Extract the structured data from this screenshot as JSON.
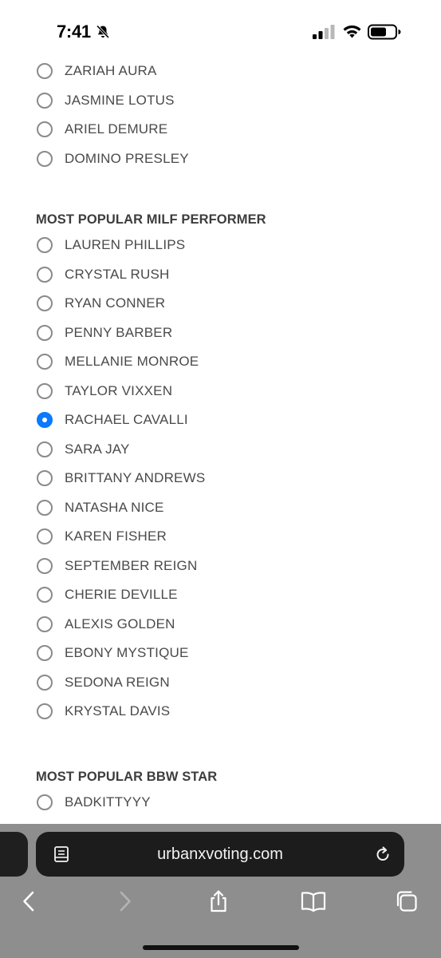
{
  "status_bar": {
    "time": "7:41"
  },
  "sections": [
    {
      "title": "",
      "options": [
        {
          "label": "ZARIAH AURA",
          "selected": false
        },
        {
          "label": "JASMINE LOTUS",
          "selected": false
        },
        {
          "label": "ARIEL DEMURE",
          "selected": false
        },
        {
          "label": "DOMINO PRESLEY",
          "selected": false
        }
      ]
    },
    {
      "title": "MOST POPULAR MILF PERFORMER",
      "options": [
        {
          "label": "LAUREN PHILLIPS",
          "selected": false
        },
        {
          "label": "CRYSTAL RUSH",
          "selected": false
        },
        {
          "label": "RYAN CONNER",
          "selected": false
        },
        {
          "label": "PENNY BARBER",
          "selected": false
        },
        {
          "label": "MELLANIE MONROE",
          "selected": false
        },
        {
          "label": "TAYLOR VIXXEN",
          "selected": false
        },
        {
          "label": "RACHAEL CAVALLI",
          "selected": true
        },
        {
          "label": "SARA JAY",
          "selected": false
        },
        {
          "label": "BRITTANY ANDREWS",
          "selected": false
        },
        {
          "label": "NATASHA NICE",
          "selected": false
        },
        {
          "label": "KAREN FISHER",
          "selected": false
        },
        {
          "label": "SEPTEMBER REIGN",
          "selected": false
        },
        {
          "label": "CHERIE DEVILLE",
          "selected": false
        },
        {
          "label": "ALEXIS GOLDEN",
          "selected": false
        },
        {
          "label": "EBONY MYSTIQUE",
          "selected": false
        },
        {
          "label": "SEDONA REIGN",
          "selected": false
        },
        {
          "label": "KRYSTAL DAVIS",
          "selected": false
        }
      ]
    },
    {
      "title": "MOST POPULAR BBW STAR",
      "options": [
        {
          "label": "BADKITTYYY",
          "selected": false
        }
      ]
    }
  ],
  "browser": {
    "url": "urbanxvoting.com"
  },
  "icons": {
    "status": [
      "bell-slash-icon",
      "cellular-signal-icon",
      "wifi-icon",
      "battery-icon"
    ],
    "address_bar": [
      "reader-page-icon",
      "reload-icon"
    ],
    "toolbar": [
      "back-chevron-icon",
      "forward-chevron-icon",
      "share-icon",
      "bookmarks-book-icon",
      "tabs-icon"
    ]
  },
  "colors": {
    "radio_selected": "#0a7aff",
    "radio_border": "#8a8a8a",
    "label_text": "#4a4a4a",
    "section_title": "#3d3d3d",
    "safari_bar": "#8e8e8e",
    "address_pill": "#1c1c1c"
  }
}
